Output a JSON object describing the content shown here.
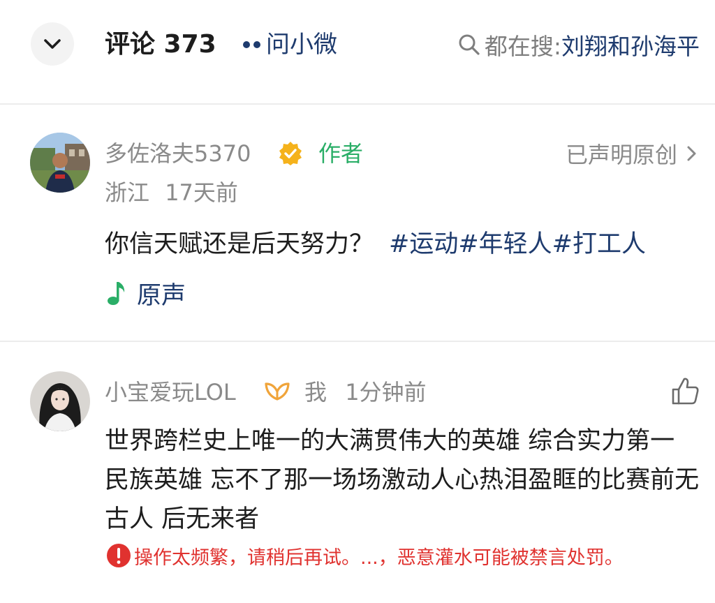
{
  "header": {
    "title": "评论 373",
    "ask_label": "问小微",
    "search_prefix": "都在搜:",
    "search_term": "刘翔和孙海平",
    "collapse_icon": "chevron-down-icon",
    "search_icon": "search-icon"
  },
  "post": {
    "username": "多佐洛夫5370",
    "author_tag": "作者",
    "original_label": "已声明原创",
    "location": "浙江",
    "time": "17天前",
    "text": "你信天赋还是后天努力？",
    "hashtags": "#运动#年轻人#打工人",
    "music_label": "原声",
    "icons": [
      "verified-badge-icon",
      "chevron-right-icon",
      "music-note-icon"
    ]
  },
  "comment": {
    "username": "小宝爱玩LOL",
    "me_label": "我",
    "time": "1分钟前",
    "text": "世界跨栏史上唯一的大满贯伟大的英雄 综合实力第一 民族英雄 忘不了那一场场激动人心热泪盈眶的比赛前无古人 后无来者",
    "error": "操作太频繁，请稍后再试。...，恶意灌水可能被禁言处罚。",
    "icons": [
      "member-badge-icon",
      "like-icon",
      "error-icon"
    ]
  },
  "colors": {
    "link_blue": "#1e3b6e",
    "author_green": "#2aae67",
    "badge_gold": "#f5b21b",
    "error_red": "#e0322f",
    "meta_gray": "#8a8a8a"
  }
}
